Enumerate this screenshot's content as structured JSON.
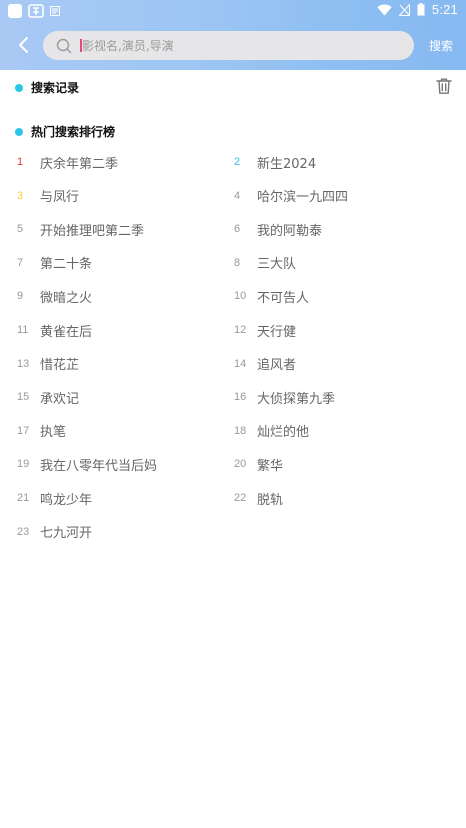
{
  "statusbar": {
    "time": "5:21"
  },
  "search": {
    "placeholder": "影视名,演员,导演",
    "value": "",
    "button_label": "搜索"
  },
  "history": {
    "title": "搜索记录"
  },
  "hot": {
    "title": "热门搜索排行榜",
    "rank_colors": {
      "1": "#e53935",
      "2": "#2ec6e6",
      "3": "#f5d33b",
      "default": "#999999"
    },
    "items": [
      {
        "rank": "1",
        "title": "庆余年第二季"
      },
      {
        "rank": "2",
        "title": "新生2024"
      },
      {
        "rank": "3",
        "title": "与凤行"
      },
      {
        "rank": "4",
        "title": "哈尔滨一九四四"
      },
      {
        "rank": "5",
        "title": "开始推理吧第二季"
      },
      {
        "rank": "6",
        "title": "我的阿勒泰"
      },
      {
        "rank": "7",
        "title": "第二十条"
      },
      {
        "rank": "8",
        "title": "三大队"
      },
      {
        "rank": "9",
        "title": "微暗之火"
      },
      {
        "rank": "10",
        "title": "不可告人"
      },
      {
        "rank": "11",
        "title": "黄雀在后"
      },
      {
        "rank": "12",
        "title": "天行健"
      },
      {
        "rank": "13",
        "title": "惜花芷"
      },
      {
        "rank": "14",
        "title": "追风者"
      },
      {
        "rank": "15",
        "title": "承欢记"
      },
      {
        "rank": "16",
        "title": "大侦探第九季"
      },
      {
        "rank": "17",
        "title": "执笔"
      },
      {
        "rank": "18",
        "title": "灿烂的他"
      },
      {
        "rank": "19",
        "title": "我在八零年代当后妈"
      },
      {
        "rank": "20",
        "title": "繁华"
      },
      {
        "rank": "21",
        "title": "鸣龙少年"
      },
      {
        "rank": "22",
        "title": "脱轨"
      },
      {
        "rank": "23",
        "title": "七九河开"
      }
    ]
  },
  "icons": {
    "back": "back-arrow-icon",
    "search": "search-icon",
    "trash": "trash-icon"
  }
}
